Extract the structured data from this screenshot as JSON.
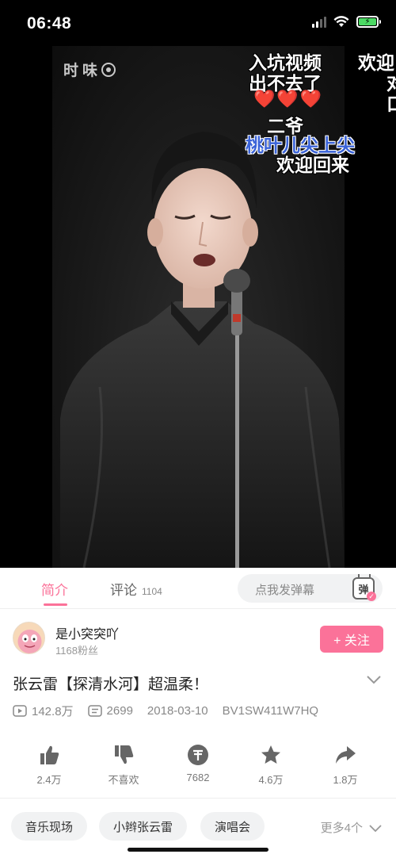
{
  "status_bar": {
    "time": "06:48"
  },
  "video": {
    "watermark": "时",
    "watermark_rest": "味",
    "danmaku": [
      {
        "text": "入坑视频"
      },
      {
        "text": "欢迎"
      },
      {
        "text": "出不去了"
      },
      {
        "text": "对"
      },
      {
        "text": "❤️❤️❤️"
      },
      {
        "text": "口"
      },
      {
        "text": "二爷"
      },
      {
        "text": "桃叶儿尖上尖"
      },
      {
        "text": "欢迎回来"
      }
    ]
  },
  "tabs": {
    "intro": "简介",
    "comments": "评论",
    "comments_count": "1104",
    "danmaku_placeholder": "点我发弹幕",
    "danmaku_toggle": "弹"
  },
  "uploader": {
    "name": "是小突突吖",
    "fans": "1168粉丝",
    "follow_label": "+ 关注"
  },
  "video_info": {
    "title": "张云雷【探清水河】超温柔！",
    "views": "142.8万",
    "danmaku_count": "2699",
    "date": "2018-03-10",
    "bvid": "BV1SW411W7HQ"
  },
  "actions": [
    {
      "icon": "thumbs-up-icon",
      "label": "2.4万"
    },
    {
      "icon": "thumbs-down-icon",
      "label": "不喜欢"
    },
    {
      "icon": "coin-icon",
      "label": "7682"
    },
    {
      "icon": "star-icon",
      "label": "4.6万"
    },
    {
      "icon": "share-icon",
      "label": "1.8万"
    }
  ],
  "tags": [
    "音乐现场",
    "小辫张云雷",
    "演唱会"
  ],
  "more_tags": "更多4个",
  "colors": {
    "accent": "#fb7299",
    "danmaku_blue": "#3a63d8"
  }
}
